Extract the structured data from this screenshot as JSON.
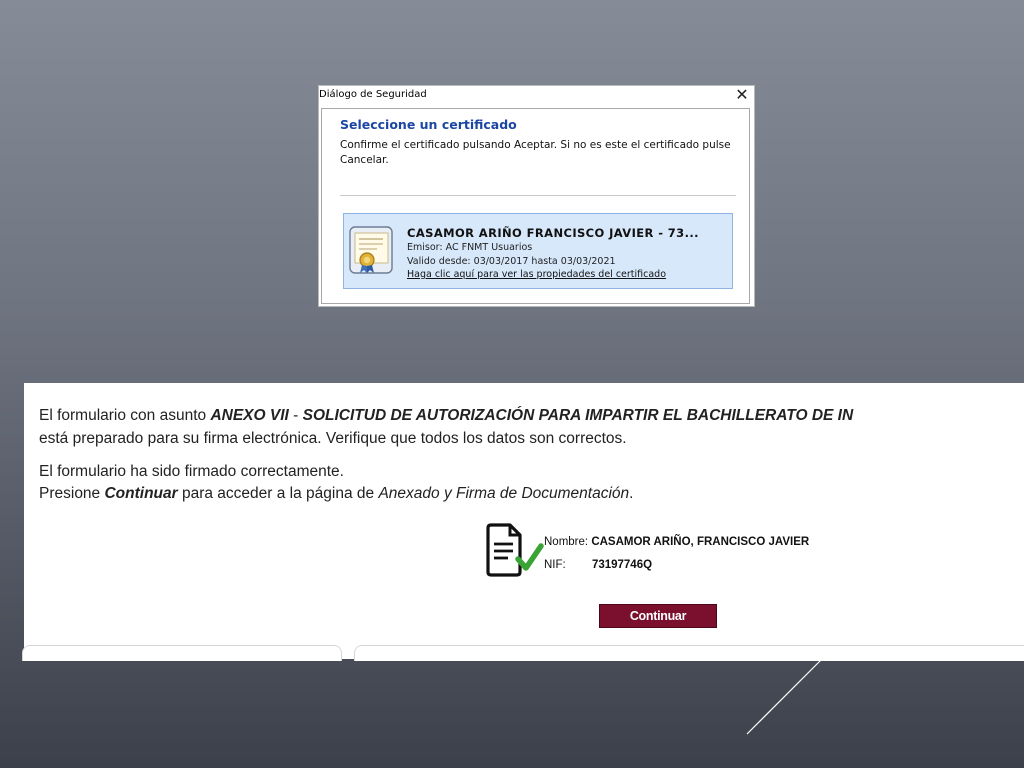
{
  "dialog": {
    "title": "Diálogo de Seguridad",
    "close_symbol": "✕",
    "heading": "Seleccione un certificado",
    "message": "Confirme el certificado pulsando Aceptar. Si no es este el certificado pulse Cancelar.",
    "certificate": {
      "icon": "certificate-icon",
      "name": "CASAMOR ARIÑO FRANCISCO JAVIER - 73...",
      "issuer": "Emisor: AC FNMT Usuarios",
      "validity": "Valido desde: 03/03/2017 hasta 03/03/2021",
      "link": "Haga clic aquí para ver las propiedades del certificado"
    }
  },
  "form": {
    "line1_prefix": "El formulario con asunto ",
    "line1_subject": "ANEXO VII",
    "line1_sep": " - ",
    "line1_subject2": "SOLICITUD DE AUTORIZACIÓN PARA IMPARTIR EL BACHILLERATO DE IN",
    "line2": "está preparado para su firma electrónica. Verifique que todos los datos son correctos.",
    "line3": "El formulario ha sido firmado correctamente.",
    "line4_prefix": "Presione ",
    "line4_action": "Continuar",
    "line4_mid": " para acceder a la página de ",
    "line4_target": "Anexado y Firma de Documentación",
    "line4_suffix": ".",
    "signer": {
      "icon": "signed-document-icon",
      "name_label": "Nombre:",
      "name_value": "CASAMOR ARIÑO, FRANCISCO JAVIER",
      "nif_label": "NIF:",
      "nif_value": "73197746Q"
    },
    "continue_button": "Continuar"
  },
  "colors": {
    "dialog_heading": "#1b46a4",
    "cert_selected_bg": "#d7e8fb",
    "button_bg": "#7a0f2e",
    "check_green": "#3aa335"
  }
}
